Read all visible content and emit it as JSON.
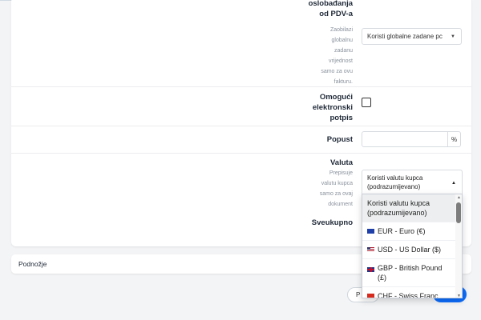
{
  "tax_exempt": {
    "label_line1": "oslobađanja",
    "label_line2": "od PDV-a",
    "hint_lines": [
      "Zaobilazi",
      "globalnu",
      "zadanu",
      "vrijednost",
      "samo za ovu",
      "fakturu."
    ],
    "select_value": "Koristi globalne zadane pc"
  },
  "esign": {
    "label_line1": "Omogući",
    "label_line2": "elektronski",
    "label_line3": "potpis"
  },
  "discount": {
    "label": "Popust",
    "addon": "%"
  },
  "currency": {
    "label": "Valuta",
    "hint_lines": [
      "Prepisuje",
      "valutu kupca",
      "samo za ovaj",
      "dokument"
    ],
    "selected_line1": "Koristi valutu kupca",
    "selected_line2": "(podrazumijevano)",
    "options": [
      {
        "line1": "Koristi valutu kupca",
        "line2": "(podrazumijevano)",
        "flag": ""
      },
      {
        "line1": "EUR - Euro (€)",
        "line2": "",
        "flag": "eu-flag-icon"
      },
      {
        "line1": "USD - US Dollar ($)",
        "line2": "",
        "flag": "us-flag-icon"
      },
      {
        "line1": "GBP - British Pound",
        "line2": "(£)",
        "flag": "gb-flag-icon"
      },
      {
        "line1": "CHF - Swiss Franc",
        "line2": "",
        "flag": "ch-flag-icon"
      }
    ]
  },
  "total": {
    "label": "Sveukupno"
  },
  "footer": {
    "label": "Podnožje"
  },
  "actions": {
    "prev_label": "P"
  },
  "colors": {
    "primary": "#0d6efd",
    "text": "#1f2937",
    "hint": "#8b939e"
  }
}
